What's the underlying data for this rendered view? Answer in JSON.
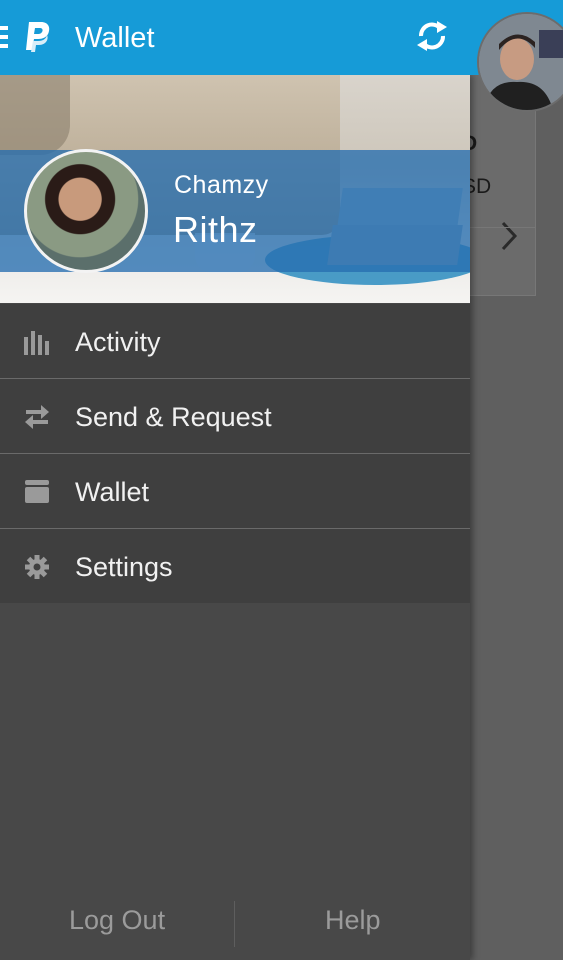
{
  "appbar": {
    "title": "Wallet",
    "brand_icon": "paypal-logo",
    "color": "#169bd7"
  },
  "profile": {
    "first_name": "Chamzy",
    "last_name": "Rithz"
  },
  "menu": {
    "items": [
      {
        "label": "Activity",
        "icon": "bar-chart-icon"
      },
      {
        "label": "Send & Request",
        "icon": "swap-arrows-icon"
      },
      {
        "label": "Wallet",
        "icon": "wallet-icon"
      },
      {
        "label": "Settings",
        "icon": "gear-icon"
      }
    ]
  },
  "footer": {
    "logout_label": "Log Out",
    "help_label": "Help"
  },
  "background_card": {
    "amount_fragment": "D",
    "currency_fragment": "SD"
  }
}
